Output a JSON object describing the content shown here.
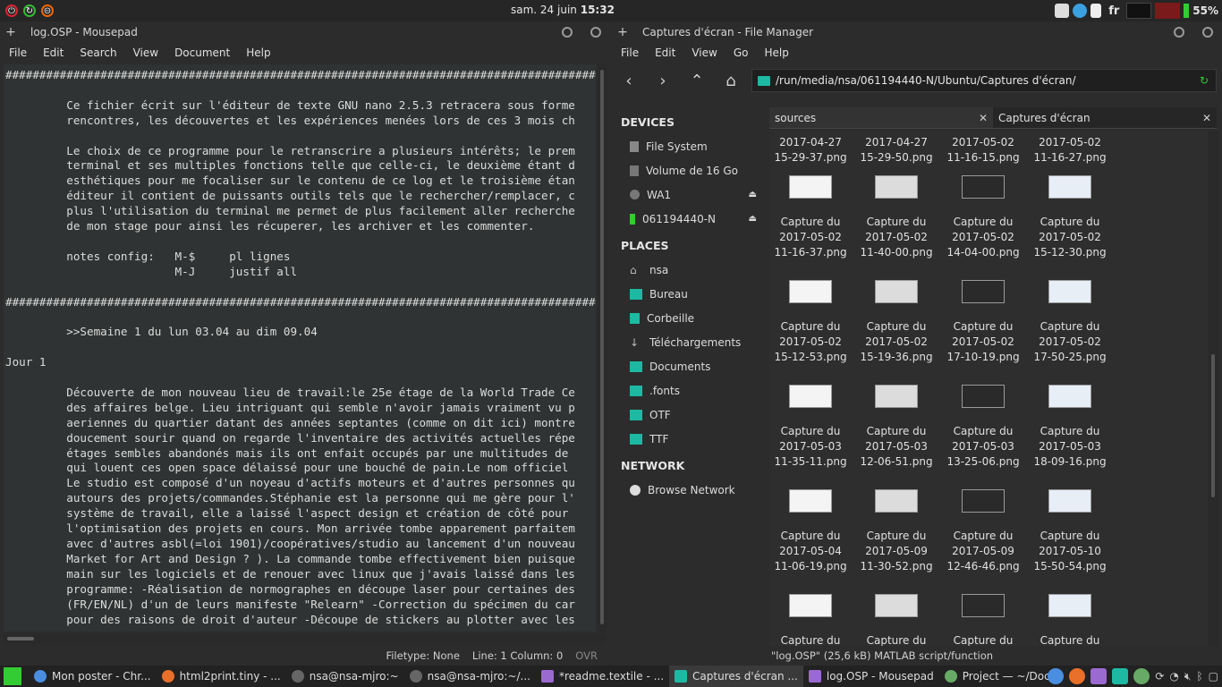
{
  "topbar": {
    "date": "sam. 24 juin",
    "time": "15:32",
    "lang": "fr",
    "battery": "55%"
  },
  "editor_window": {
    "title": "log.OSP - Mousepad",
    "menu": [
      "File",
      "Edit",
      "Search",
      "View",
      "Document",
      "Help"
    ],
    "lines": [
      "#############################################################################################",
      "",
      "         Ce fichier écrit sur l'éditeur de texte GNU nano 2.5.3 retracera sous forme",
      "         rencontres, les découvertes et les expériences menées lors de ces 3 mois ch",
      "",
      "         Le choix de ce programme pour le retranscrire a plusieurs intérêts; le prem",
      "         terminal et ses multiples fonctions telle que celle-ci, le deuxième étant d",
      "         esthétiques pour me focaliser sur le contenu de ce log et le troisième étan",
      "         éditeur il contient de puissants outils tels que le rechercher/remplacer, c",
      "         plus l'utilisation du terminal me permet de plus facilement aller recherche",
      "         de mon stage pour ainsi les récuperer, les archiver et les commenter.",
      "",
      "         notes config:   M-$     pl lignes",
      "                         M-J     justif all",
      "",
      "#############################################################################################",
      "",
      "         >>Semaine 1 du lun 03.04 au dim 09.04",
      "",
      "Jour 1",
      "",
      "         Découverte de mon nouveau lieu de travail:le 25e étage de la World Trade Ce",
      "         des affaires belge. Lieu intriguant qui semble n'avoir jamais vraiment vu p",
      "         aeriennes du quartier datant des années septantes (comme on dit ici) montre",
      "         doucement sourir quand on regarde l'inventaire des activités actuelles répe",
      "         étages sembles abandonés mais ils ont enfait occupés par une multitudes de",
      "         qui louent ces open space délaissé pour une bouché de pain.Le nom officiel",
      "         Le studio est composé d'un noyeau d'actifs moteurs et d'autres personnes qu",
      "         autours des projets/commandes.Stéphanie est la personne qui me gère pour l'",
      "         système de travail, elle a laissé l'aspect design et création de côté pour",
      "         l'optimisation des projets en cours. Mon arrivée tombe apparement parfaitem",
      "         avec d'autres asbl(=loi 1901)/coopératives/studio au lancement d'un nouveau",
      "         Market for Art and Design ? ). La commande tombe effectivement bien puisque",
      "         main sur les logiciels et de renouer avec linux que j'avais laissé dans les",
      "         programme: -Réalisation de normographes en découpe laser pour certaines des",
      "         (FR/EN/NL) d'un de leurs manifeste \"Relearn\" -Correction du spécimen du car",
      "         pour des raisons de droit d'auteur -Découpe de stickers au plotter avec les"
    ],
    "status": {
      "filetype": "Filetype: None",
      "position": "Line: 1 Column: 0",
      "ovr": "OVR"
    }
  },
  "fm_window": {
    "title": "Captures d'écran - File Manager",
    "menu": [
      "File",
      "Edit",
      "View",
      "Go",
      "Help"
    ],
    "path": "/run/media/nsa/061194440-N/Ubuntu/Captures d'écran/",
    "devices_header": "DEVICES",
    "places_header": "PLACES",
    "network_header": "NETWORK",
    "devices": [
      "File System",
      "Volume de 16 Go",
      "WA1",
      "061194440-N"
    ],
    "places": [
      "nsa",
      "Bureau",
      "Corbeille",
      "Téléchargements",
      "Documents",
      ".fonts",
      "OTF",
      "TTF"
    ],
    "network": [
      "Browse Network"
    ],
    "tabs": [
      "sources",
      "Captures d'écran"
    ],
    "files": [
      {
        "l1": "2017-04-27",
        "l2": "15-29-37.png"
      },
      {
        "l1": "2017-04-27",
        "l2": "15-29-50.png"
      },
      {
        "l1": "2017-05-02",
        "l2": "11-16-15.png"
      },
      {
        "l1": "2017-05-02",
        "l2": "11-16-27.png"
      },
      {
        "l0": "Capture du",
        "l1": "2017-05-02",
        "l2": "11-16-37.png"
      },
      {
        "l0": "Capture du",
        "l1": "2017-05-02",
        "l2": "11-40-00.png"
      },
      {
        "l0": "Capture du",
        "l1": "2017-05-02",
        "l2": "14-04-00.png"
      },
      {
        "l0": "Capture du",
        "l1": "2017-05-02",
        "l2": "15-12-30.png"
      },
      {
        "l0": "Capture du",
        "l1": "2017-05-02",
        "l2": "15-12-53.png"
      },
      {
        "l0": "Capture du",
        "l1": "2017-05-02",
        "l2": "15-19-36.png"
      },
      {
        "l0": "Capture du",
        "l1": "2017-05-02",
        "l2": "17-10-19.png"
      },
      {
        "l0": "Capture du",
        "l1": "2017-05-02",
        "l2": "17-50-25.png"
      },
      {
        "l0": "Capture du",
        "l1": "2017-05-03",
        "l2": "11-35-11.png"
      },
      {
        "l0": "Capture du",
        "l1": "2017-05-03",
        "l2": "12-06-51.png"
      },
      {
        "l0": "Capture du",
        "l1": "2017-05-03",
        "l2": "13-25-06.png"
      },
      {
        "l0": "Capture du",
        "l1": "2017-05-03",
        "l2": "18-09-16.png"
      },
      {
        "l0": "Capture du",
        "l1": "2017-05-04",
        "l2": "11-06-19.png"
      },
      {
        "l0": "Capture du",
        "l1": "2017-05-09",
        "l2": "11-30-52.png"
      },
      {
        "l0": "Capture du",
        "l1": "2017-05-09",
        "l2": "12-46-46.png"
      },
      {
        "l0": "Capture du",
        "l1": "2017-05-10",
        "l2": "15-50-54.png"
      },
      {
        "l0": "Capture du"
      },
      {
        "l0": "Capture du"
      },
      {
        "l0": "Capture du"
      },
      {
        "l0": "Capture du"
      }
    ],
    "status": "\"log.OSP\" (25,6 kB) MATLAB script/function"
  },
  "taskbar": {
    "items": [
      "Mon poster - Chr...",
      "html2print.tiny - ...",
      "nsa@nsa-mjro:~",
      "nsa@nsa-mjro:~/...",
      "*readme.textile - ...",
      "Captures d'écran ...",
      "log.OSP - Mousepad",
      "Project — ~/Doc..."
    ]
  }
}
